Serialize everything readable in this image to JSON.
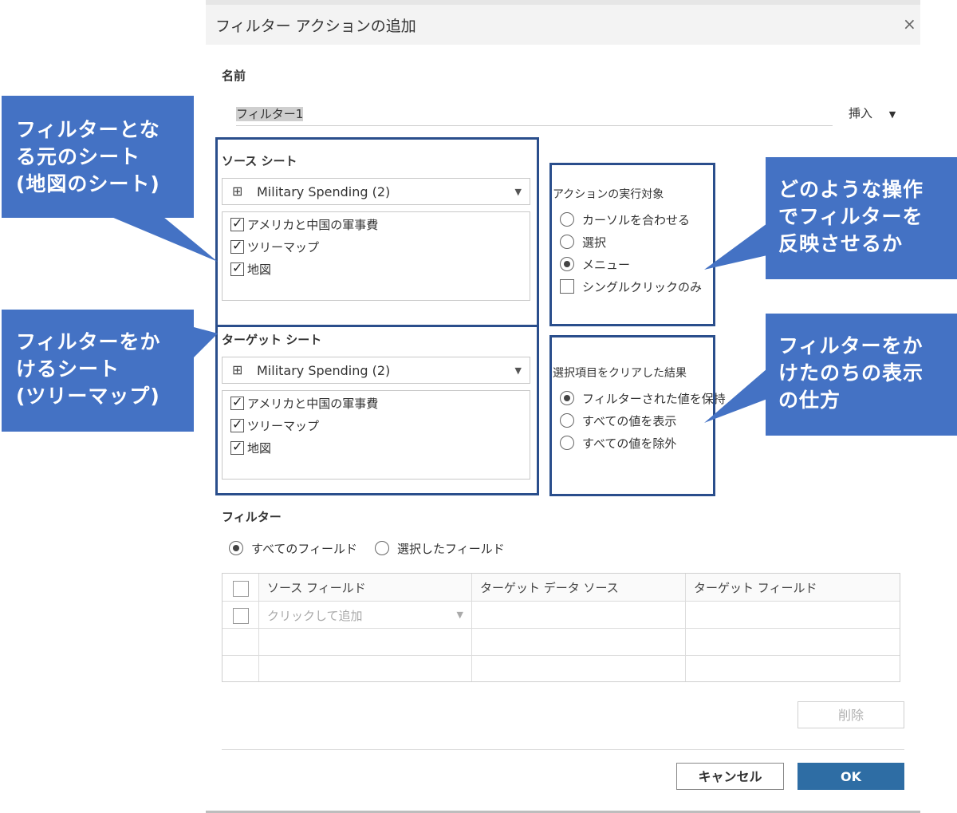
{
  "dialog": {
    "title": "フィルター アクションの追加",
    "close_glyph": "×"
  },
  "name_section": {
    "label": "名前",
    "value": "フィルター1",
    "insert_label": "挿入"
  },
  "source": {
    "label": "ソース シート",
    "dropdown_value": "Military Spending (2)",
    "sheets": [
      {
        "label": "アメリカと中国の軍事費",
        "checked": true
      },
      {
        "label": "ツリーマップ",
        "checked": true
      },
      {
        "label": "地図",
        "checked": true
      }
    ]
  },
  "target": {
    "label": "ターゲット シート",
    "dropdown_value": "Military Spending (2)",
    "sheets": [
      {
        "label": "アメリカと中国の軍事費",
        "checked": true
      },
      {
        "label": "ツリーマップ",
        "checked": true
      },
      {
        "label": "地図",
        "checked": true
      }
    ]
  },
  "run_action": {
    "label": "アクションの実行対象",
    "options": [
      "カーソルを合わせる",
      "選択",
      "メニュー"
    ],
    "selected": "メニュー",
    "single_click_label": "シングルクリックのみ",
    "single_click_checked": false
  },
  "clear_selection": {
    "label": "選択項目をクリアした結果",
    "options": [
      "フィルターされた値を保持",
      "すべての値を表示",
      "すべての値を除外"
    ],
    "selected": "フィルターされた値を保持"
  },
  "filter_section": {
    "label": "フィルター",
    "options": [
      "すべてのフィールド",
      "選択したフィールド"
    ],
    "selected": "すべてのフィールド",
    "columns": [
      "ソース フィールド",
      "ターゲット データ ソース",
      "ターゲット フィールド"
    ],
    "add_placeholder": "クリックして追加"
  },
  "buttons": {
    "delete": "削除",
    "cancel": "キャンセル",
    "ok": "OK"
  },
  "callouts": {
    "source": "フィルターとな\nる元のシート\n(地図のシート)",
    "target": "フィルターをか\nけるシート\n(ツリーマップ)",
    "run": "どのような操作\nでフィルターを\n反映させるか",
    "clear": "フィルターをか\nけたのちの表示\nの仕方"
  },
  "colors": {
    "callout_fill": "#4472c4",
    "highlight_border": "#2a4e8c",
    "ok_button": "#2e6da4"
  }
}
